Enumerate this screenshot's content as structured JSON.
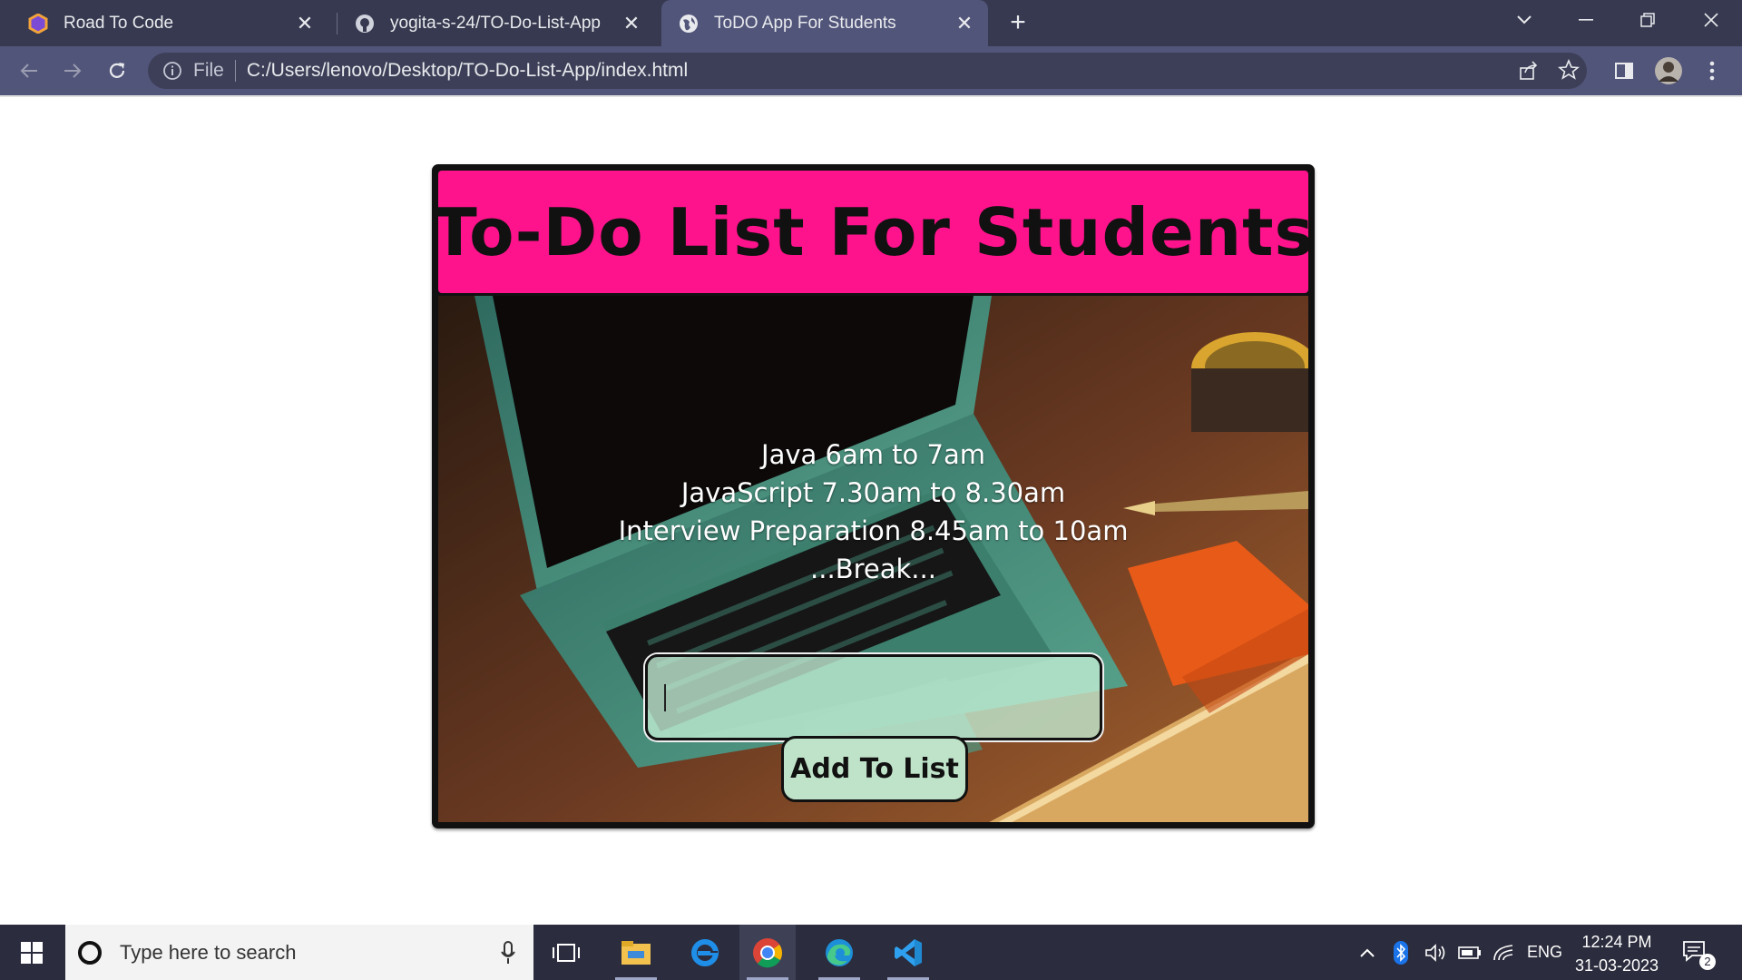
{
  "browser": {
    "tabs": [
      {
        "title": "Road To Code",
        "icon": "road-to-code-icon",
        "active": false
      },
      {
        "title": "yogita-s-24/TO-Do-List-App",
        "icon": "github-icon",
        "active": false
      },
      {
        "title": "ToDO App For Students",
        "icon": "globe-icon",
        "active": true
      }
    ],
    "address": {
      "scheme_label": "File",
      "url": "C:/Users/lenovo/Desktop/TO-Do-List-App/index.html"
    }
  },
  "app": {
    "title": "To-Do List For Students",
    "tasks": [
      "Java 6am to 7am",
      "JavaScript 7.30am to 8.30am",
      "Interview Preparation 8.45am to 10am",
      "...Break..."
    ],
    "input_value": "",
    "add_button_label": "Add To List",
    "colors": {
      "header": "#fe138c",
      "button": "#bfe3c9"
    }
  },
  "taskbar": {
    "search_placeholder": "Type here to search",
    "language": "ENG",
    "time": "12:24 PM",
    "date": "31-03-2023",
    "notification_count": "2"
  }
}
